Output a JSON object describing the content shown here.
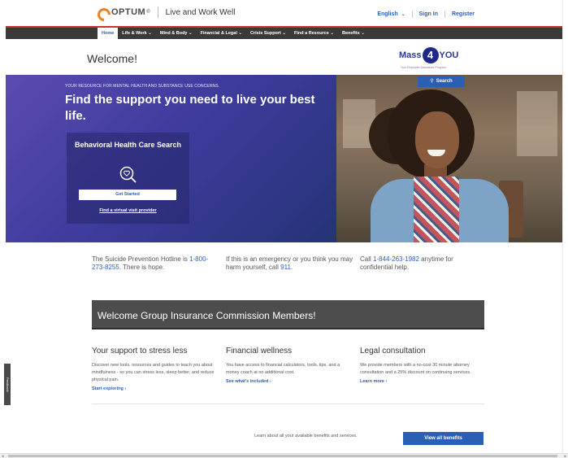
{
  "header": {
    "logo_text": "OPTUM",
    "logo_tm": "®",
    "tagline": "Live and Work Well",
    "language": "English",
    "sign_in": "Sign In",
    "register": "Register"
  },
  "nav": {
    "items": [
      {
        "label": "Home"
      },
      {
        "label": "Life & Work ⌄"
      },
      {
        "label": "Mind & Body ⌄"
      },
      {
        "label": "Financial & Legal ⌄"
      },
      {
        "label": "Crisis Support ⌄"
      },
      {
        "label": "Find a Resource ⌄"
      },
      {
        "label": "Benefits ⌄"
      }
    ]
  },
  "welcome": {
    "title": "Welcome!",
    "brand_mass": "Mass",
    "brand_four": "4",
    "brand_you": "YOU",
    "brand_sub": "Your Employee Assistance Program"
  },
  "hero": {
    "kicker": "YOUR RESOURCE FOR MENTAL HEALTH AND SUBSTANCE USE CONCERNS.",
    "headline": "Find the support you need to live your best life.",
    "card_title": "Behavioral Health Care Search",
    "card_button": "Get Started",
    "card_link": "Find a virtual visit provider",
    "search_button": "Search"
  },
  "info": {
    "suicide_text": "The Suicide Prevention Hotline is ",
    "suicide_number": "1-800-273-8255",
    "suicide_tail": ". There is hope.",
    "emergency_text": "If this is an emergency or you think you may harm yourself, call ",
    "emergency_number": "911",
    "emergency_tail": ".",
    "call_text": "Call ",
    "call_number": "1-844-263-1982",
    "call_tail": " anytime for confidential help."
  },
  "banner": {
    "text": "Welcome Group Insurance Commission Members!"
  },
  "columns": [
    {
      "title": "Your support to stress less",
      "body": "Discover new tools, resources and guides to teach you about mindfulness - so you can stress less, sleep better, and reduce physical pain.",
      "link": "Start exploring ›"
    },
    {
      "title": "Financial wellness",
      "body": "You have access to financial calculators, tools, tips, and a money coach at no additional cost.",
      "link": "See what's included ›"
    },
    {
      "title": "Legal consultation",
      "body": "We provide members with a no-cost 30 minute attorney consultation and a 25% discount on continuing services.",
      "link": "Learn more ›"
    }
  ],
  "benefits": {
    "text": "Learn about all your available benefits and services.",
    "button": "View all benefits"
  },
  "feedback": {
    "label": "Feedback"
  },
  "colors": {
    "brand_blue": "#2b5fb4",
    "optum_orange": "#f2811d",
    "nav_dark": "#3a3a3a",
    "hero_purple": "#4b43a8",
    "banner_gray": "#4d4d4d"
  }
}
